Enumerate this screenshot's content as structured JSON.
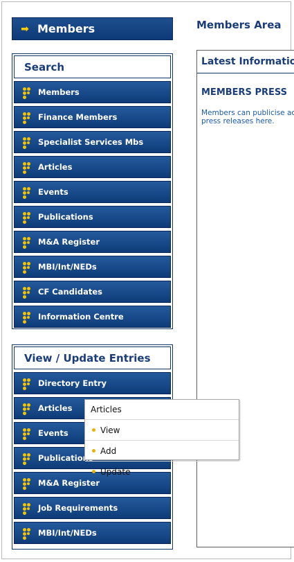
{
  "header": {
    "members_label": "Members",
    "members_area_title": "Members Area"
  },
  "search_panel": {
    "title": "Search",
    "items": [
      {
        "label": "Members"
      },
      {
        "label": "Finance Members"
      },
      {
        "label": "Specialist Services Mbs"
      },
      {
        "label": "Articles"
      },
      {
        "label": "Events"
      },
      {
        "label": "Publications"
      },
      {
        "label": "M&A Register"
      },
      {
        "label": "MBI/Int/NEDs"
      },
      {
        "label": "CF Candidates"
      },
      {
        "label": "Information Centre"
      }
    ]
  },
  "update_panel": {
    "title": "View / Update Entries",
    "items": [
      {
        "label": "Directory Entry"
      },
      {
        "label": "Articles"
      },
      {
        "label": "Events"
      },
      {
        "label": "Publications"
      },
      {
        "label": "M&A Register"
      },
      {
        "label": "Job Requirements"
      },
      {
        "label": "MBI/Int/NEDs"
      }
    ]
  },
  "content": {
    "header": "Latest Information",
    "subtitle": "MEMBERS PRESS",
    "text": "Members can publicise activities, press releases here."
  },
  "popup": {
    "title": "Articles",
    "options": [
      {
        "label": "View"
      },
      {
        "label": "Add"
      },
      {
        "label": "Update"
      }
    ]
  },
  "colors": {
    "nav_blue": "#0e3b78",
    "title_blue": "#1a3d7a",
    "icon_yellow": "#f2c400"
  }
}
